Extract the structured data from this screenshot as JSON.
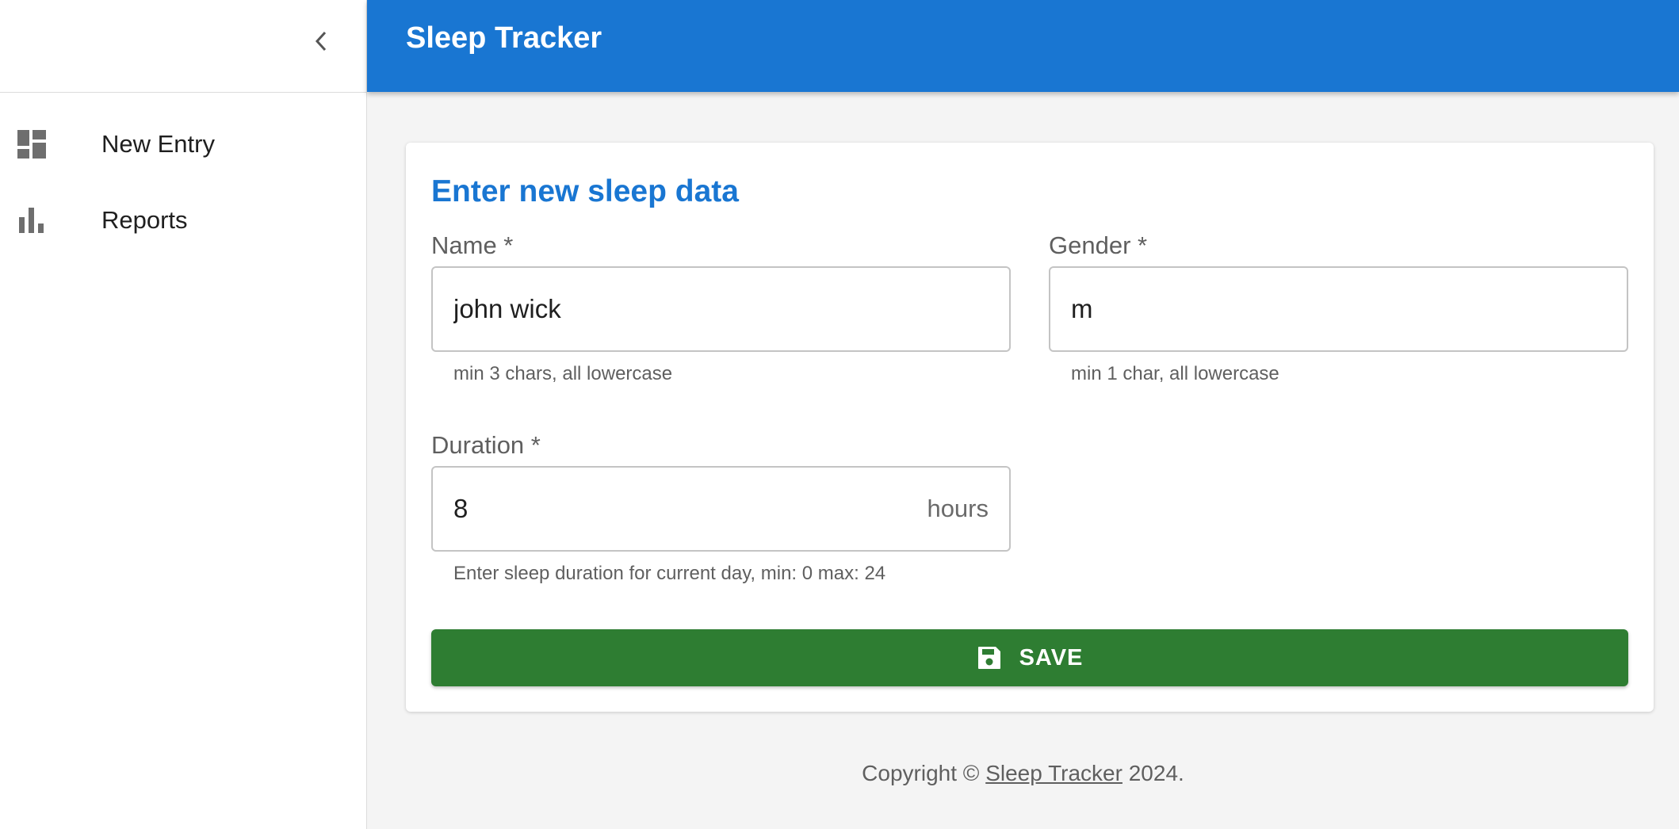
{
  "app": {
    "title": "Sleep Tracker"
  },
  "sidebar": {
    "collapse_icon": "chevron-left-icon",
    "items": [
      {
        "label": "New Entry",
        "icon": "dashboard-icon"
      },
      {
        "label": "Reports",
        "icon": "bar-chart-icon"
      }
    ]
  },
  "form": {
    "title": "Enter new sleep data",
    "name": {
      "label": "Name *",
      "value": "john wick",
      "hint": "min 3 chars, all lowercase"
    },
    "gender": {
      "label": "Gender *",
      "value": "m",
      "hint": "min 1 char, all lowercase"
    },
    "duration": {
      "label": "Duration *",
      "value": "8",
      "suffix": "hours",
      "hint": "Enter sleep duration for current day, min: 0 max: 24"
    },
    "save_label": "SAVE",
    "save_icon": "save-icon"
  },
  "footer": {
    "prefix": "Copyright © ",
    "link": "Sleep Tracker",
    "suffix": " 2024."
  },
  "colors": {
    "primary": "#1976d2",
    "save": "#2e7d32",
    "background": "#f4f4f4"
  }
}
